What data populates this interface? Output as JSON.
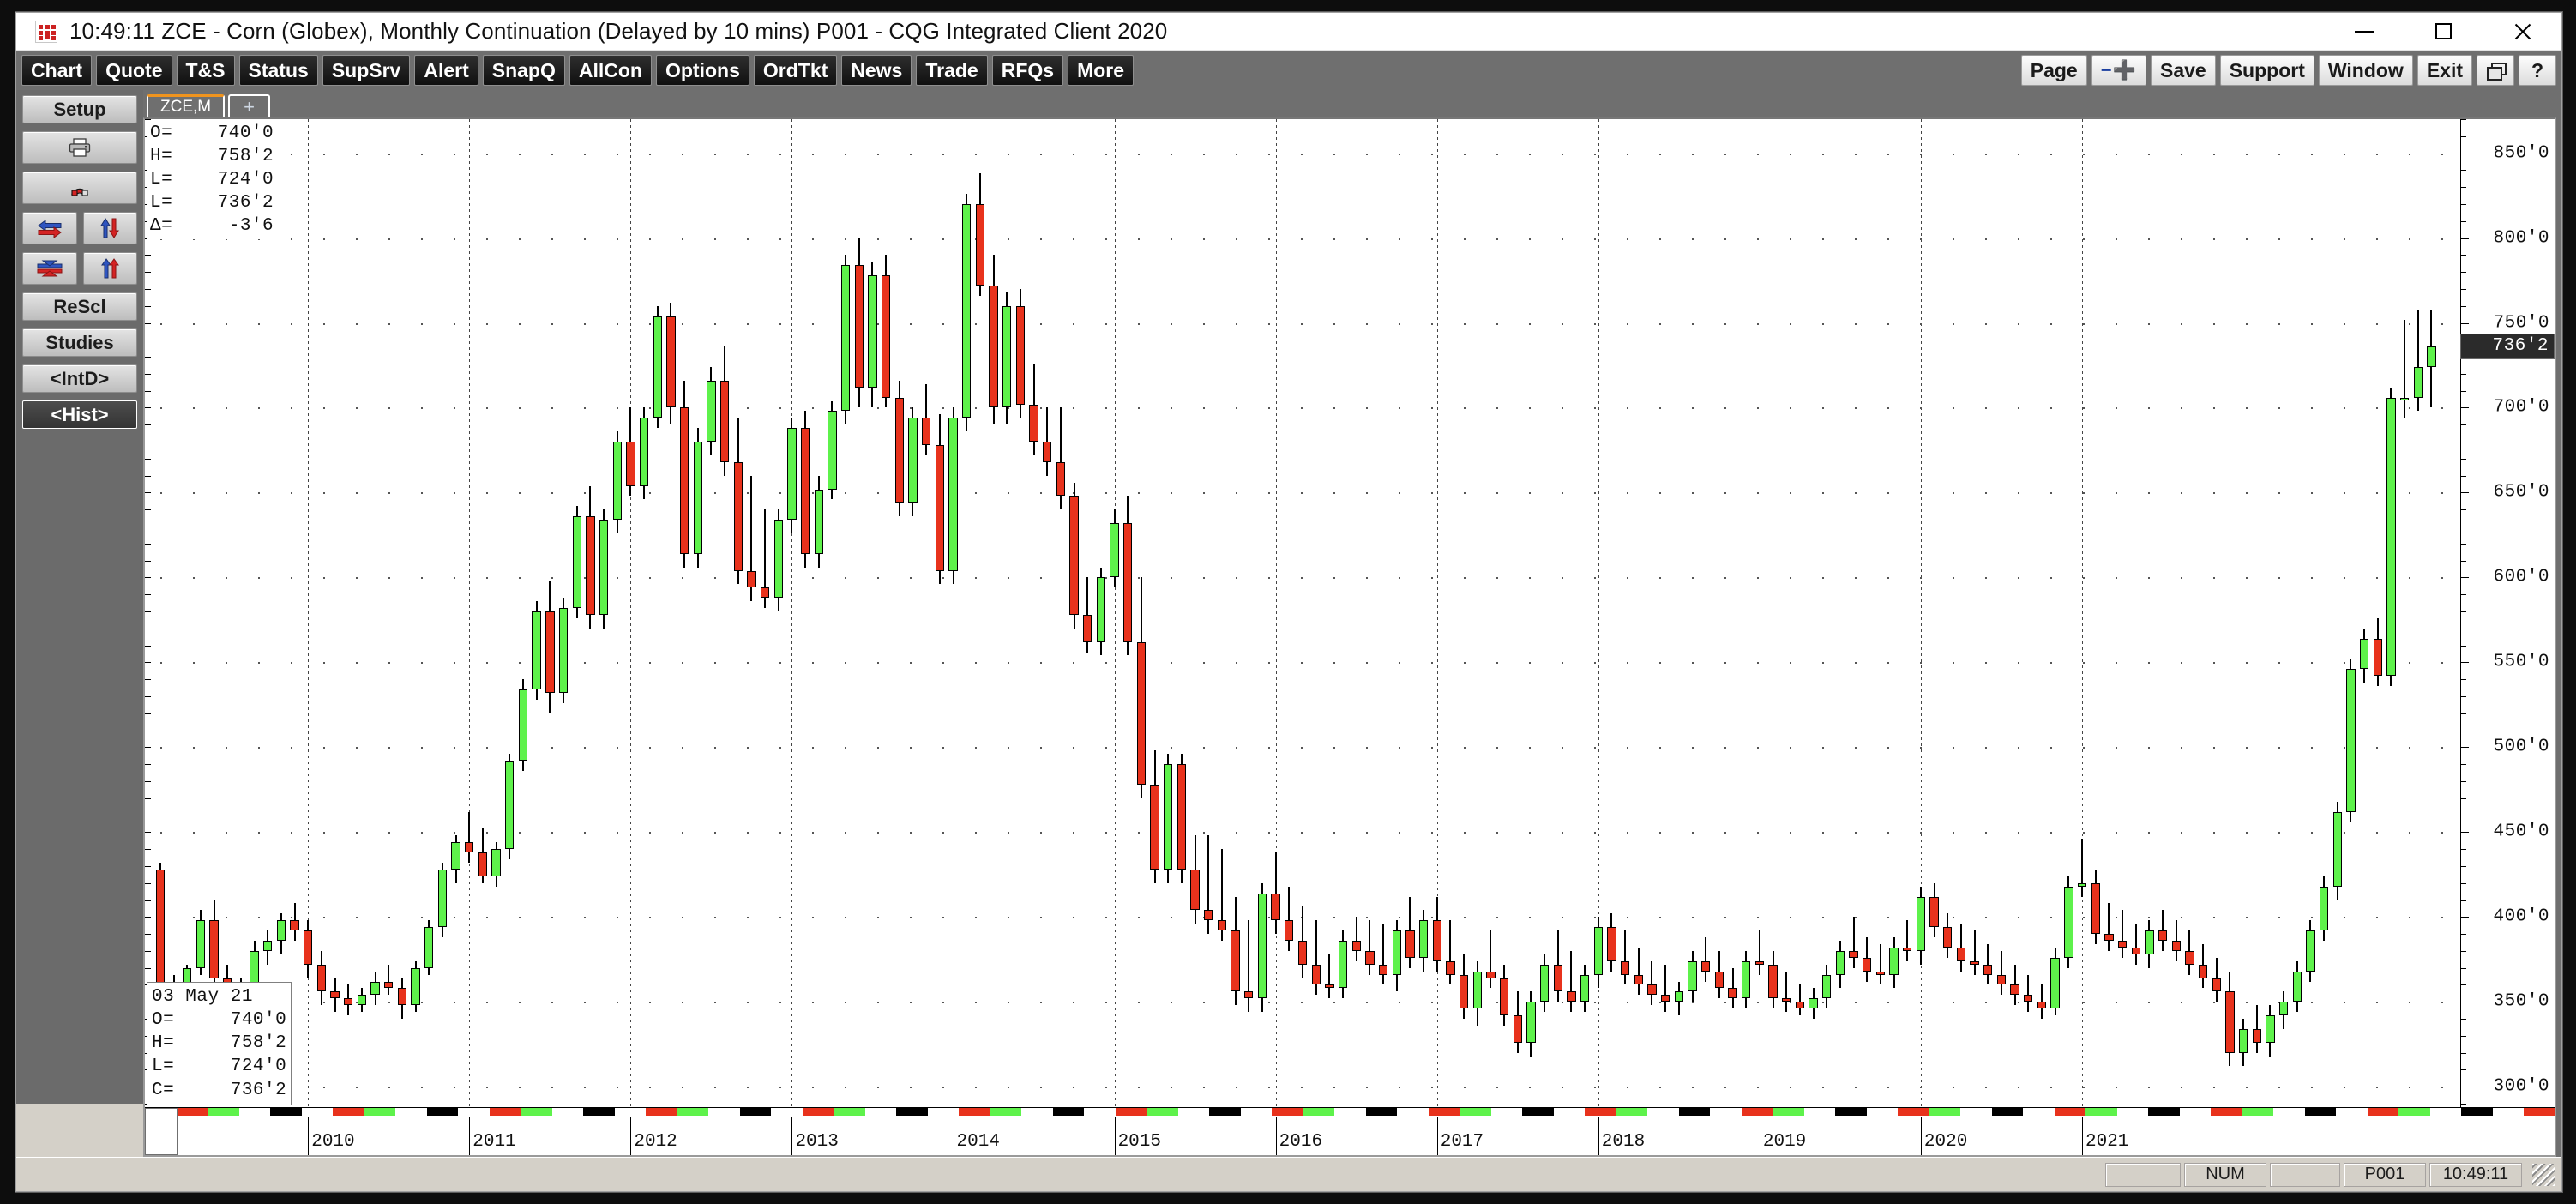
{
  "window": {
    "title": "10:49:11   ZCE - Corn (Globex), Monthly Continuation (Delayed by 10 mins)   P001 - CQG Integrated Client 2020",
    "icon": "cqg-logo-icon",
    "minimize": "minimize-icon",
    "maximize": "maximize-icon",
    "close": "close-icon"
  },
  "toolbar": {
    "left_buttons": [
      {
        "label": "Chart"
      },
      {
        "label": "Quote"
      },
      {
        "label": "T&S"
      },
      {
        "label": "Status"
      },
      {
        "label": "SupSrv"
      },
      {
        "label": "Alert"
      },
      {
        "label": "SnapQ"
      },
      {
        "label": "AllCon"
      },
      {
        "label": "Options"
      },
      {
        "label": "OrdTkt"
      },
      {
        "label": "News"
      },
      {
        "label": "Trade"
      },
      {
        "label": "RFQs"
      },
      {
        "label": "More"
      }
    ],
    "right_buttons": [
      {
        "label": "Page"
      },
      {
        "label": "-+"
      },
      {
        "label": "Save"
      },
      {
        "label": "Support"
      },
      {
        "label": "Window"
      },
      {
        "label": "Exit"
      },
      {
        "label": "restore-icon"
      },
      {
        "label": "?"
      }
    ]
  },
  "sidebar": {
    "items": [
      {
        "label": "Setup",
        "icon": "setup-button"
      },
      {
        "label": "",
        "icon": "printer-icon"
      },
      {
        "label": "",
        "icon": "magnet-icon"
      },
      {
        "label": "",
        "icon": "horizontal-arrows-icon"
      },
      {
        "label": "",
        "icon": "vertical-arrows-icon"
      },
      {
        "label": "",
        "icon": "collapse-arrows-icon"
      },
      {
        "label": "",
        "icon": "expand-arrows-icon"
      },
      {
        "label": "ReScl",
        "icon": "rescale-button"
      },
      {
        "label": "Studies",
        "icon": "studies-button"
      },
      {
        "label": "<IntD>",
        "icon": "intraday-button"
      },
      {
        "label": "<Hist>",
        "icon": "history-button",
        "selected": true
      }
    ]
  },
  "tabs": {
    "items": [
      {
        "label": "ZCE,M",
        "active": true
      },
      {
        "label": "+",
        "active": false
      }
    ]
  },
  "quote_header": {
    "rows": [
      {
        "key": "O=",
        "value": "740'0"
      },
      {
        "key": "H=",
        "value": "758'2"
      },
      {
        "key": "L=",
        "value": "724'0"
      },
      {
        "key": "L=",
        "value": "736'2"
      },
      {
        "key": "Δ=",
        "value": "-3'6"
      }
    ],
    "text": "O=    740'0\nH=    758'2\nL=    724'0\nL=    736'2\nΔ=     -3'6"
  },
  "cursor_info": {
    "date": "03 May 21",
    "open": "740'0",
    "high": "758'2",
    "low": "724'0",
    "close": "736'2",
    "text": "03 May 21\nO=     740'0\nH=     758'2\nL=     724'0\nC=     736'2"
  },
  "statusbar": {
    "num": "NUM",
    "page": "P001",
    "time": "10:49:11"
  },
  "colors": {
    "up": "#5ef24b",
    "down": "#e8321c",
    "accent": "#f0941e",
    "axis": "#000000",
    "last_price_bg": "#2b2b2b"
  },
  "chart_data": {
    "type": "candlestick",
    "title": "ZCE - Corn (Globex), Monthly Continuation",
    "symbol": "ZCE,M",
    "xlabel": "",
    "ylabel": "",
    "ylim": [
      288,
      870
    ],
    "yticks": [
      "850'0",
      "800'0",
      "750'0",
      "700'0",
      "650'0",
      "600'0",
      "550'0",
      "500'0",
      "450'0",
      "400'0",
      "350'0",
      "300'0"
    ],
    "ytick_values": [
      850,
      800,
      750,
      700,
      650,
      600,
      550,
      500,
      450,
      400,
      350,
      300
    ],
    "last_price_label": "736'2",
    "last_price_value": 736.25,
    "xticks": [
      "2010",
      "2011",
      "2012",
      "2013",
      "2014",
      "2015",
      "2016",
      "2017",
      "2018",
      "2019",
      "2020",
      "2021"
    ],
    "grid": "dotted",
    "legend": "none",
    "ohlc": [
      [
        428,
        432,
        352,
        360
      ],
      [
        360,
        366,
        346,
        352
      ],
      [
        352,
        372,
        344,
        370
      ],
      [
        370,
        404,
        366,
        398
      ],
      [
        398,
        410,
        358,
        364
      ],
      [
        364,
        372,
        352,
        358
      ],
      [
        358,
        364,
        352,
        356
      ],
      [
        356,
        386,
        350,
        380
      ],
      [
        380,
        392,
        372,
        386
      ],
      [
        386,
        402,
        378,
        398
      ],
      [
        398,
        408,
        386,
        392
      ],
      [
        392,
        398,
        364,
        372
      ],
      [
        372,
        380,
        348,
        356
      ],
      [
        356,
        364,
        344,
        352
      ],
      [
        352,
        360,
        342,
        348
      ],
      [
        348,
        358,
        344,
        354
      ],
      [
        354,
        368,
        348,
        362
      ],
      [
        362,
        372,
        354,
        358
      ],
      [
        358,
        364,
        340,
        348
      ],
      [
        348,
        374,
        344,
        370
      ],
      [
        370,
        398,
        366,
        394
      ],
      [
        394,
        432,
        388,
        428
      ],
      [
        428,
        448,
        420,
        444
      ],
      [
        444,
        462,
        432,
        438
      ],
      [
        438,
        452,
        420,
        424
      ],
      [
        424,
        444,
        418,
        440
      ],
      [
        440,
        496,
        434,
        492
      ],
      [
        492,
        540,
        486,
        534
      ],
      [
        534,
        586,
        528,
        580
      ],
      [
        580,
        598,
        520,
        532
      ],
      [
        532,
        588,
        526,
        582
      ],
      [
        582,
        642,
        576,
        636
      ],
      [
        636,
        654,
        570,
        578
      ],
      [
        578,
        640,
        570,
        634
      ],
      [
        634,
        686,
        626,
        680
      ],
      [
        680,
        700,
        648,
        654
      ],
      [
        654,
        700,
        646,
        694
      ],
      [
        694,
        760,
        688,
        754
      ],
      [
        754,
        762,
        690,
        700
      ],
      [
        700,
        716,
        606,
        614
      ],
      [
        614,
        688,
        606,
        680
      ],
      [
        680,
        724,
        672,
        716
      ],
      [
        716,
        736,
        660,
        668
      ],
      [
        668,
        694,
        596,
        604
      ],
      [
        604,
        660,
        586,
        594
      ],
      [
        594,
        640,
        582,
        588
      ],
      [
        588,
        640,
        580,
        634
      ],
      [
        634,
        694,
        626,
        688
      ],
      [
        688,
        698,
        606,
        614
      ],
      [
        614,
        660,
        606,
        652
      ],
      [
        652,
        704,
        646,
        698
      ],
      [
        698,
        790,
        690,
        784
      ],
      [
        784,
        800,
        700,
        712
      ],
      [
        712,
        786,
        700,
        778
      ],
      [
        778,
        790,
        700,
        706
      ],
      [
        706,
        716,
        636,
        644
      ],
      [
        644,
        700,
        636,
        694
      ],
      [
        694,
        714,
        672,
        678
      ],
      [
        678,
        696,
        596,
        604
      ],
      [
        604,
        700,
        596,
        694
      ],
      [
        694,
        826,
        686,
        820
      ],
      [
        820,
        838,
        766,
        772
      ],
      [
        772,
        790,
        690,
        700
      ],
      [
        700,
        768,
        690,
        760
      ],
      [
        760,
        770,
        694,
        702
      ],
      [
        702,
        726,
        672,
        680
      ],
      [
        680,
        700,
        660,
        668
      ],
      [
        668,
        700,
        640,
        648
      ],
      [
        648,
        656,
        570,
        578
      ],
      [
        578,
        600,
        556,
        562
      ],
      [
        562,
        606,
        554,
        600
      ],
      [
        600,
        640,
        594,
        632
      ],
      [
        632,
        648,
        554,
        562
      ],
      [
        562,
        600,
        470,
        478
      ],
      [
        478,
        498,
        420,
        428
      ],
      [
        428,
        496,
        420,
        490
      ],
      [
        490,
        496,
        420,
        428
      ],
      [
        428,
        448,
        396,
        404
      ],
      [
        404,
        448,
        390,
        398
      ],
      [
        398,
        440,
        386,
        392
      ],
      [
        392,
        412,
        348,
        356
      ],
      [
        356,
        398,
        344,
        352
      ],
      [
        352,
        420,
        344,
        414
      ],
      [
        414,
        438,
        390,
        398
      ],
      [
        398,
        418,
        380,
        386
      ],
      [
        386,
        406,
        364,
        372
      ],
      [
        372,
        398,
        354,
        360
      ],
      [
        360,
        378,
        352,
        358
      ],
      [
        358,
        392,
        352,
        386
      ],
      [
        386,
        400,
        374,
        380
      ],
      [
        380,
        398,
        366,
        372
      ],
      [
        372,
        396,
        360,
        366
      ],
      [
        366,
        398,
        356,
        392
      ],
      [
        392,
        412,
        370,
        376
      ],
      [
        376,
        404,
        368,
        398
      ],
      [
        398,
        412,
        368,
        374
      ],
      [
        374,
        398,
        360,
        366
      ],
      [
        366,
        378,
        340,
        346
      ],
      [
        346,
        374,
        336,
        368
      ],
      [
        368,
        392,
        358,
        364
      ],
      [
        364,
        372,
        336,
        342
      ],
      [
        342,
        356,
        320,
        326
      ],
      [
        326,
        356,
        318,
        350
      ],
      [
        350,
        378,
        344,
        372
      ],
      [
        372,
        392,
        350,
        356
      ],
      [
        356,
        380,
        344,
        350
      ],
      [
        350,
        372,
        344,
        366
      ],
      [
        366,
        400,
        358,
        394
      ],
      [
        394,
        402,
        368,
        374
      ],
      [
        374,
        392,
        360,
        366
      ],
      [
        366,
        382,
        354,
        360
      ],
      [
        360,
        374,
        348,
        354
      ],
      [
        354,
        372,
        344,
        350
      ],
      [
        350,
        362,
        342,
        356
      ],
      [
        356,
        380,
        350,
        374
      ],
      [
        374,
        388,
        362,
        368
      ],
      [
        368,
        380,
        352,
        358
      ],
      [
        358,
        370,
        346,
        352
      ],
      [
        352,
        380,
        346,
        374
      ],
      [
        374,
        392,
        366,
        372
      ],
      [
        372,
        380,
        346,
        352
      ],
      [
        352,
        368,
        344,
        350
      ],
      [
        350,
        360,
        342,
        346
      ],
      [
        346,
        358,
        340,
        352
      ],
      [
        352,
        372,
        346,
        366
      ],
      [
        366,
        386,
        358,
        380
      ],
      [
        380,
        400,
        370,
        376
      ],
      [
        376,
        388,
        362,
        368
      ],
      [
        368,
        384,
        360,
        366
      ],
      [
        366,
        388,
        358,
        382
      ],
      [
        382,
        398,
        374,
        380
      ],
      [
        380,
        418,
        372,
        412
      ],
      [
        412,
        420,
        388,
        394
      ],
      [
        394,
        402,
        376,
        382
      ],
      [
        382,
        396,
        368,
        374
      ],
      [
        374,
        392,
        366,
        372
      ],
      [
        372,
        384,
        360,
        366
      ],
      [
        366,
        380,
        354,
        360
      ],
      [
        360,
        372,
        348,
        354
      ],
      [
        354,
        366,
        344,
        350
      ],
      [
        350,
        360,
        340,
        346
      ],
      [
        346,
        382,
        342,
        376
      ],
      [
        376,
        424,
        370,
        418
      ],
      [
        418,
        446,
        412,
        420
      ],
      [
        420,
        428,
        384,
        390
      ],
      [
        390,
        408,
        380,
        386
      ],
      [
        386,
        404,
        376,
        382
      ],
      [
        382,
        396,
        372,
        378
      ],
      [
        378,
        398,
        370,
        392
      ],
      [
        392,
        404,
        380,
        386
      ],
      [
        386,
        398,
        374,
        380
      ],
      [
        380,
        392,
        366,
        372
      ],
      [
        372,
        384,
        358,
        364
      ],
      [
        364,
        376,
        350,
        356
      ],
      [
        356,
        368,
        312,
        320
      ],
      [
        320,
        340,
        312,
        334
      ],
      [
        334,
        348,
        320,
        326
      ],
      [
        326,
        348,
        318,
        342
      ],
      [
        342,
        356,
        334,
        350
      ],
      [
        350,
        374,
        344,
        368
      ],
      [
        368,
        398,
        362,
        392
      ],
      [
        392,
        424,
        386,
        418
      ],
      [
        418,
        468,
        410,
        462
      ],
      [
        462,
        552,
        456,
        546
      ],
      [
        546,
        570,
        538,
        564
      ],
      [
        564,
        576,
        536,
        542
      ],
      [
        542,
        712,
        536,
        706
      ],
      [
        706,
        752,
        694,
        706
      ],
      [
        706,
        758,
        698,
        724
      ],
      [
        724,
        758,
        700,
        736
      ]
    ]
  }
}
